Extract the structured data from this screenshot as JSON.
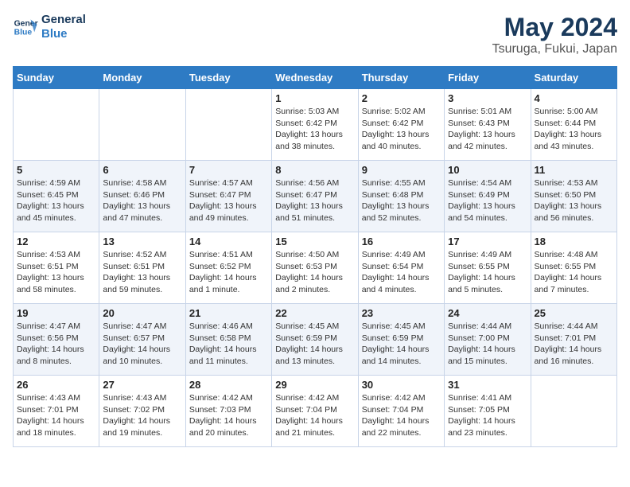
{
  "logo": {
    "line1": "General",
    "line2": "Blue"
  },
  "title": "May 2024",
  "subtitle": "Tsuruga, Fukui, Japan",
  "days_of_week": [
    "Sunday",
    "Monday",
    "Tuesday",
    "Wednesday",
    "Thursday",
    "Friday",
    "Saturday"
  ],
  "weeks": [
    [
      {
        "day": "",
        "info": ""
      },
      {
        "day": "",
        "info": ""
      },
      {
        "day": "",
        "info": ""
      },
      {
        "day": "1",
        "info": "Sunrise: 5:03 AM\nSunset: 6:42 PM\nDaylight: 13 hours\nand 38 minutes."
      },
      {
        "day": "2",
        "info": "Sunrise: 5:02 AM\nSunset: 6:42 PM\nDaylight: 13 hours\nand 40 minutes."
      },
      {
        "day": "3",
        "info": "Sunrise: 5:01 AM\nSunset: 6:43 PM\nDaylight: 13 hours\nand 42 minutes."
      },
      {
        "day": "4",
        "info": "Sunrise: 5:00 AM\nSunset: 6:44 PM\nDaylight: 13 hours\nand 43 minutes."
      }
    ],
    [
      {
        "day": "5",
        "info": "Sunrise: 4:59 AM\nSunset: 6:45 PM\nDaylight: 13 hours\nand 45 minutes."
      },
      {
        "day": "6",
        "info": "Sunrise: 4:58 AM\nSunset: 6:46 PM\nDaylight: 13 hours\nand 47 minutes."
      },
      {
        "day": "7",
        "info": "Sunrise: 4:57 AM\nSunset: 6:47 PM\nDaylight: 13 hours\nand 49 minutes."
      },
      {
        "day": "8",
        "info": "Sunrise: 4:56 AM\nSunset: 6:47 PM\nDaylight: 13 hours\nand 51 minutes."
      },
      {
        "day": "9",
        "info": "Sunrise: 4:55 AM\nSunset: 6:48 PM\nDaylight: 13 hours\nand 52 minutes."
      },
      {
        "day": "10",
        "info": "Sunrise: 4:54 AM\nSunset: 6:49 PM\nDaylight: 13 hours\nand 54 minutes."
      },
      {
        "day": "11",
        "info": "Sunrise: 4:53 AM\nSunset: 6:50 PM\nDaylight: 13 hours\nand 56 minutes."
      }
    ],
    [
      {
        "day": "12",
        "info": "Sunrise: 4:53 AM\nSunset: 6:51 PM\nDaylight: 13 hours\nand 58 minutes."
      },
      {
        "day": "13",
        "info": "Sunrise: 4:52 AM\nSunset: 6:51 PM\nDaylight: 13 hours\nand 59 minutes."
      },
      {
        "day": "14",
        "info": "Sunrise: 4:51 AM\nSunset: 6:52 PM\nDaylight: 14 hours\nand 1 minute."
      },
      {
        "day": "15",
        "info": "Sunrise: 4:50 AM\nSunset: 6:53 PM\nDaylight: 14 hours\nand 2 minutes."
      },
      {
        "day": "16",
        "info": "Sunrise: 4:49 AM\nSunset: 6:54 PM\nDaylight: 14 hours\nand 4 minutes."
      },
      {
        "day": "17",
        "info": "Sunrise: 4:49 AM\nSunset: 6:55 PM\nDaylight: 14 hours\nand 5 minutes."
      },
      {
        "day": "18",
        "info": "Sunrise: 4:48 AM\nSunset: 6:55 PM\nDaylight: 14 hours\nand 7 minutes."
      }
    ],
    [
      {
        "day": "19",
        "info": "Sunrise: 4:47 AM\nSunset: 6:56 PM\nDaylight: 14 hours\nand 8 minutes."
      },
      {
        "day": "20",
        "info": "Sunrise: 4:47 AM\nSunset: 6:57 PM\nDaylight: 14 hours\nand 10 minutes."
      },
      {
        "day": "21",
        "info": "Sunrise: 4:46 AM\nSunset: 6:58 PM\nDaylight: 14 hours\nand 11 minutes."
      },
      {
        "day": "22",
        "info": "Sunrise: 4:45 AM\nSunset: 6:59 PM\nDaylight: 14 hours\nand 13 minutes."
      },
      {
        "day": "23",
        "info": "Sunrise: 4:45 AM\nSunset: 6:59 PM\nDaylight: 14 hours\nand 14 minutes."
      },
      {
        "day": "24",
        "info": "Sunrise: 4:44 AM\nSunset: 7:00 PM\nDaylight: 14 hours\nand 15 minutes."
      },
      {
        "day": "25",
        "info": "Sunrise: 4:44 AM\nSunset: 7:01 PM\nDaylight: 14 hours\nand 16 minutes."
      }
    ],
    [
      {
        "day": "26",
        "info": "Sunrise: 4:43 AM\nSunset: 7:01 PM\nDaylight: 14 hours\nand 18 minutes."
      },
      {
        "day": "27",
        "info": "Sunrise: 4:43 AM\nSunset: 7:02 PM\nDaylight: 14 hours\nand 19 minutes."
      },
      {
        "day": "28",
        "info": "Sunrise: 4:42 AM\nSunset: 7:03 PM\nDaylight: 14 hours\nand 20 minutes."
      },
      {
        "day": "29",
        "info": "Sunrise: 4:42 AM\nSunset: 7:04 PM\nDaylight: 14 hours\nand 21 minutes."
      },
      {
        "day": "30",
        "info": "Sunrise: 4:42 AM\nSunset: 7:04 PM\nDaylight: 14 hours\nand 22 minutes."
      },
      {
        "day": "31",
        "info": "Sunrise: 4:41 AM\nSunset: 7:05 PM\nDaylight: 14 hours\nand 23 minutes."
      },
      {
        "day": "",
        "info": ""
      }
    ]
  ]
}
